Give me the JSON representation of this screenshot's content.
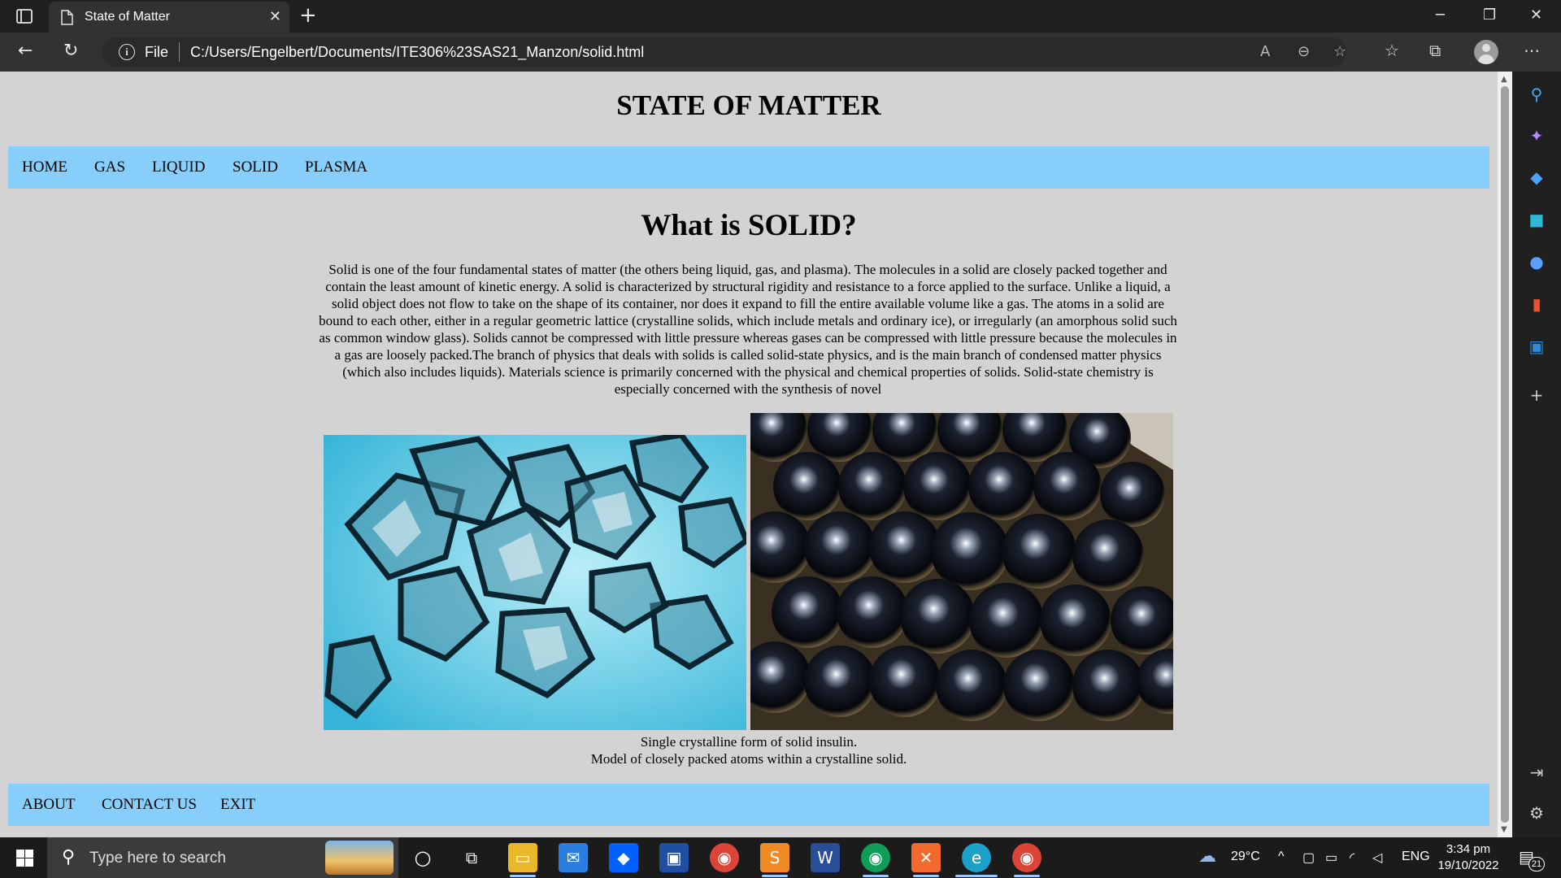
{
  "browser": {
    "tab_title": "State of Matter",
    "address_scheme": "File",
    "address_url": "C:/Users/Engelbert/Documents/ITE306%23SAS21_Manzon/solid.html"
  },
  "page": {
    "site_title": "STATE OF MATTER",
    "nav": [
      "HOME",
      "GAS",
      "LIQUID",
      "SOLID",
      "PLASMA"
    ],
    "heading": "What is SOLID?",
    "paragraph": "Solid is one of the four fundamental states of matter (the others being liquid, gas, and plasma). The molecules in a solid are closely packed together and contain the least amount of kinetic energy. A solid is characterized by structural rigidity and resistance to a force applied to the surface. Unlike a liquid, a solid object does not flow to take on the shape of its container, nor does it expand to fill the entire available volume like a gas. The atoms in a solid are bound to each other, either in a regular geometric lattice (crystalline solids, which include metals and ordinary ice), or irregularly (an amorphous solid such as common window glass). Solids cannot be compressed with little pressure whereas gases can be compressed with little pressure because the molecules in a gas are loosely packed.The branch of physics that deals with solids is called solid-state physics, and is the main branch of condensed matter physics (which also includes liquids). Materials science is primarily concerned with the physical and chemical properties of solids. Solid-state chemistry is especially concerned with the synthesis of novel",
    "caption_1": "Single crystalline form of solid insulin.",
    "caption_2": "Model of closely packed atoms within a crystalline solid.",
    "footer_nav": [
      "ABOUT",
      "CONTACT US",
      "EXIT"
    ]
  },
  "taskbar": {
    "search_placeholder": "Type here to search",
    "weather": "29°C",
    "language": "ENG",
    "time": "3:34 pm",
    "date": "19/10/2022",
    "notification_count": "21"
  },
  "colors": {
    "page_bg": "#d3d3d3",
    "nav_band": "#87cefa"
  }
}
